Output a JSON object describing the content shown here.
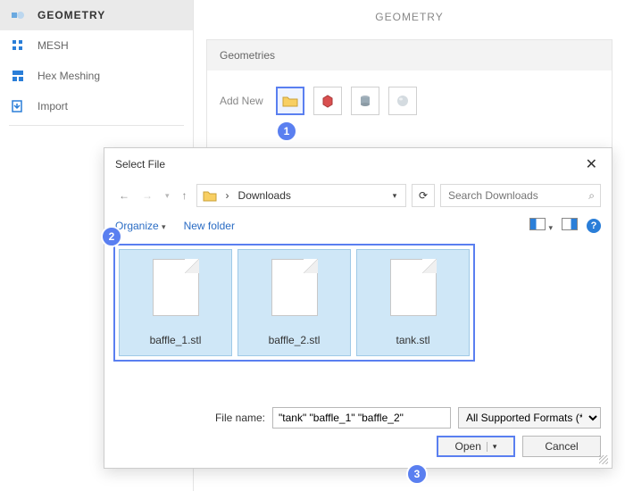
{
  "sidebar": {
    "items": [
      {
        "label": "GEOMETRY"
      },
      {
        "label": "MESH"
      },
      {
        "label": "Hex Meshing"
      },
      {
        "label": "Import"
      }
    ]
  },
  "panel": {
    "title": "GEOMETRY",
    "section_header": "Geometries",
    "add_new_label": "Add New"
  },
  "callouts": {
    "c1": "1",
    "c2": "2",
    "c3": "3"
  },
  "dialog": {
    "title": "Select File",
    "breadcrumb": "Downloads",
    "search_placeholder": "Search Downloads",
    "organize": "Organize",
    "newfolder": "New folder",
    "files": [
      {
        "name": "baffle_1.stl"
      },
      {
        "name": "baffle_2.stl"
      },
      {
        "name": "tank.stl"
      }
    ],
    "file_name_label": "File name:",
    "file_name_value": "\"tank\" \"baffle_1\" \"baffle_2\"",
    "filter": "All Supported Formats (*.*)",
    "open": "Open",
    "cancel": "Cancel"
  }
}
